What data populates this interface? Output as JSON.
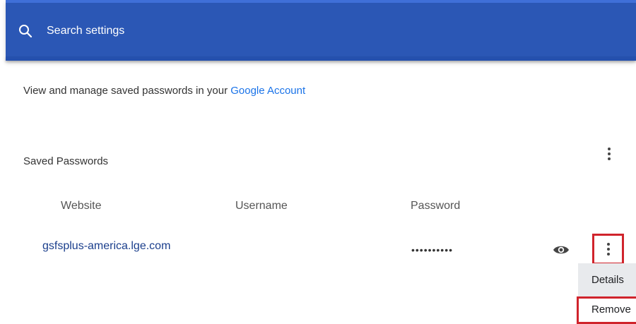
{
  "search": {
    "placeholder": "Search settings",
    "icon": "search-icon"
  },
  "intro": {
    "text": "View and manage saved passwords in your ",
    "link_label": "Google Account"
  },
  "saved_passwords": {
    "title": "Saved Passwords",
    "columns": [
      "Website",
      "Username",
      "Password"
    ],
    "rows": [
      {
        "website": "gsfsplus-america.lge.com",
        "username": "",
        "password_mask": "••••••••••"
      }
    ]
  },
  "row_menu": {
    "items": [
      "Details",
      "Remove"
    ]
  },
  "colors": {
    "header_bg": "#2b57b5",
    "link": "#1a73e8",
    "site_link": "#1a3e8c",
    "highlight": "#d0242c"
  }
}
